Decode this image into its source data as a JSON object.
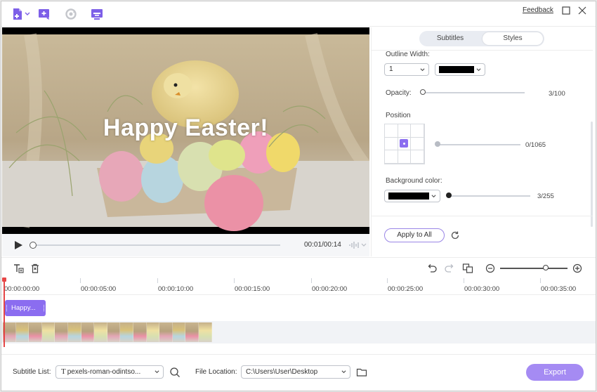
{
  "toolbar": {
    "icons": [
      "add-file-icon",
      "dropdown-icon",
      "add-subtitle-icon",
      "refresh-icon",
      "subtitle-screen-icon"
    ],
    "feedback_label": "Feedback"
  },
  "video": {
    "subtitle_text": "Happy Easter!"
  },
  "player": {
    "time": "00:01/00:14",
    "progress": 0
  },
  "panel": {
    "tabs": [
      {
        "label": "Subtitles",
        "active": false
      },
      {
        "label": "Styles",
        "active": true
      }
    ],
    "outline_width": {
      "label": "Outline Width:",
      "value": "1",
      "color": "#000000"
    },
    "opacity": {
      "label": "Opacity:",
      "value_text": "3/100",
      "value": 3,
      "max": 100
    },
    "position": {
      "label": "Position",
      "selected_cell": 4,
      "value_text": "0/1065",
      "value": 0,
      "max": 1065
    },
    "background_color": {
      "label": "Background color:",
      "color": "#000000",
      "value_text": "3/255",
      "value": 3,
      "max": 255
    },
    "apply_label": "Apply to All"
  },
  "timeline": {
    "ticks": [
      "00:00:00:00",
      "00:00:05:00",
      "00:00:10:00",
      "00:00:15:00",
      "00:00:20:00",
      "00:00:25:00",
      "00:00:30:00",
      "00:00:35:00"
    ],
    "subtitle_clip": "Happy...",
    "zoom_level": 0.65
  },
  "bottom": {
    "subtitle_list_label": "Subtitle List:",
    "subtitle_list_value": "pexels-roman-odintso...",
    "file_location_label": "File Location:",
    "file_location_value": "C:\\Users\\User\\Desktop",
    "export_label": "Export"
  },
  "colors": {
    "accent": "#8b6df0",
    "export": "#a58bf3"
  }
}
